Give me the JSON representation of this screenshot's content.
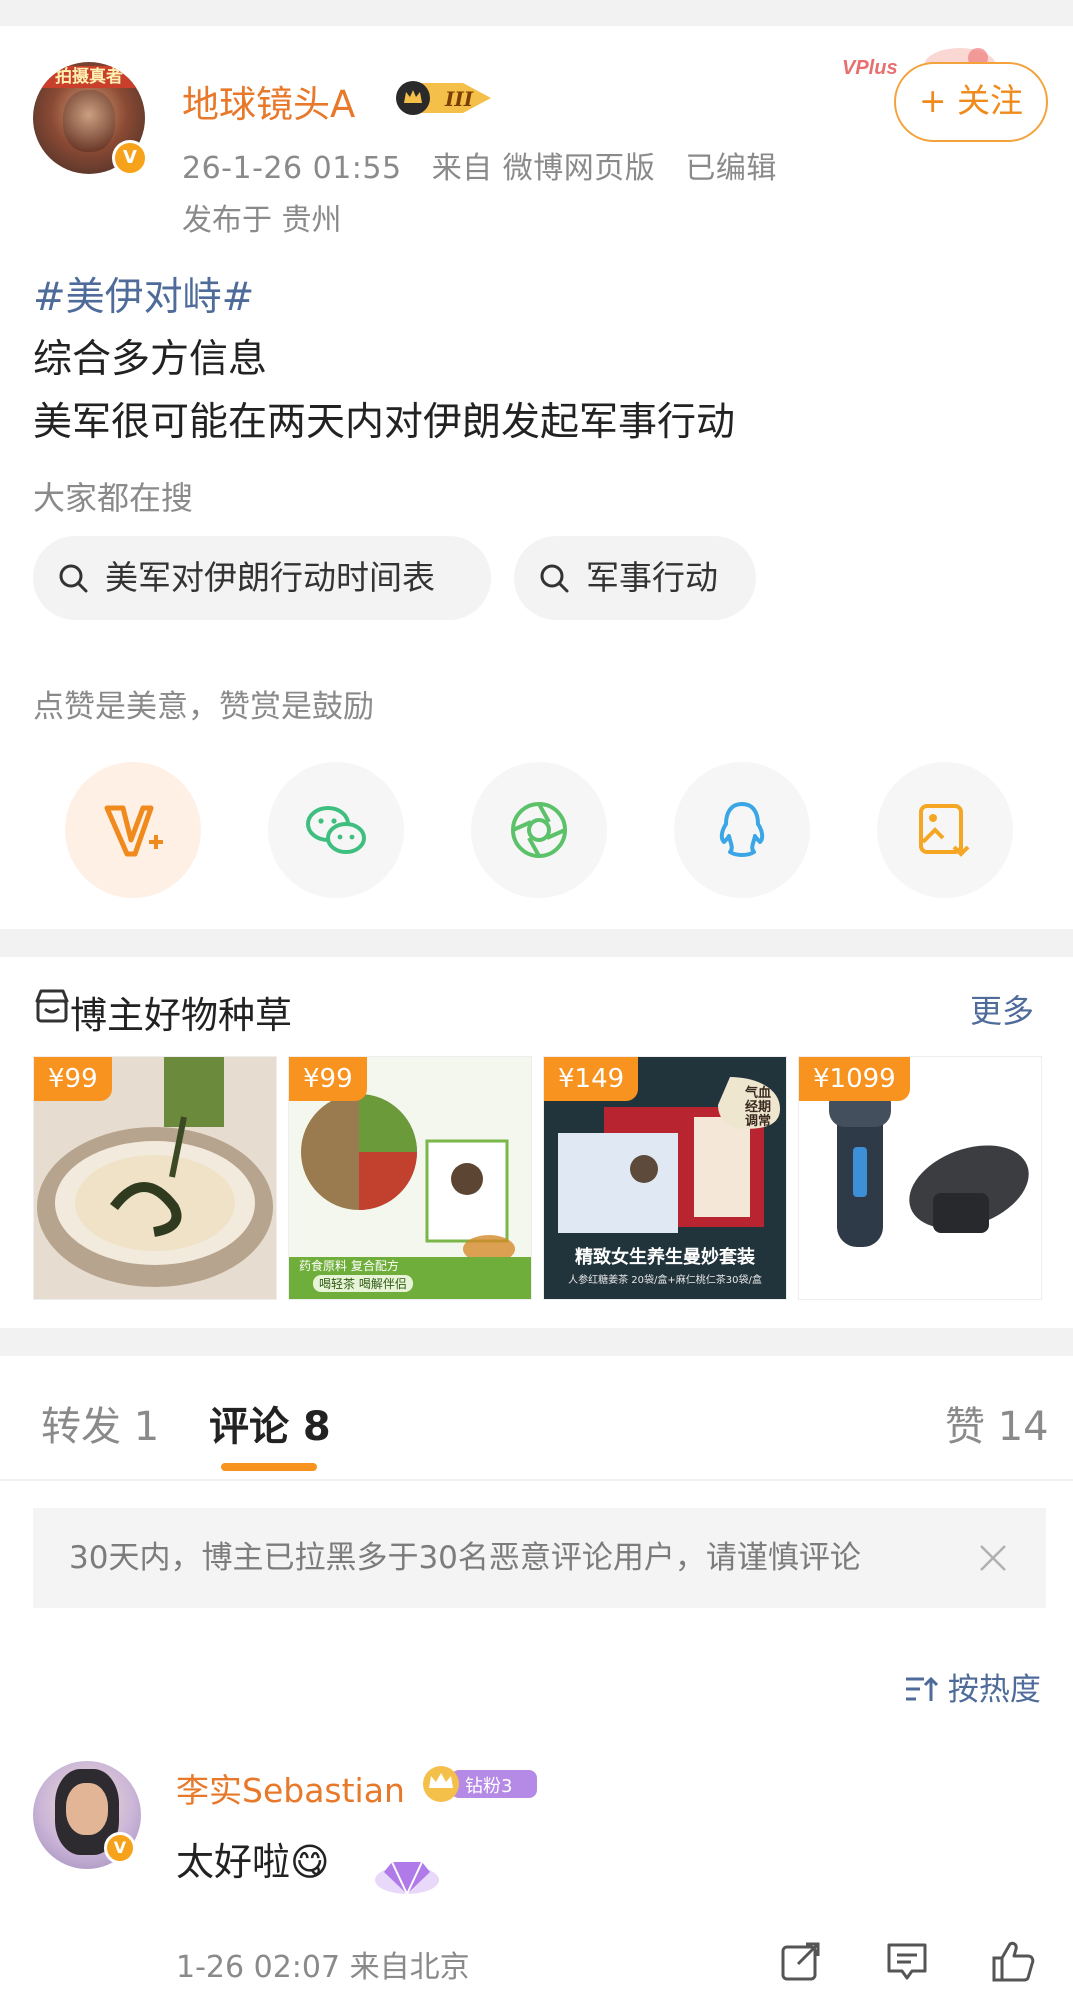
{
  "post": {
    "author": {
      "name": "地球镜头A",
      "level_badge": "III",
      "avatar_banner": "拍摄真者"
    },
    "timestamp": "26-1-26 01:55",
    "source": "来自 微博网页版",
    "edited": "已编辑",
    "location": "发布于 贵州",
    "follow_label": "+ 关注",
    "hashtag": "#美伊对峙#",
    "lines": [
      "综合多方信息",
      "美军很可能在两天内对伊朗发起军事行动"
    ],
    "search_hint": "大家都在搜",
    "search_chips": [
      "美军对伊朗行动时间表",
      "军事行动"
    ],
    "tip_text": "点赞是美意，赞赏是鼓励",
    "share_icons": [
      "vplus-reward-icon",
      "wechat-icon",
      "moments-icon",
      "qq-icon",
      "save-image-icon"
    ]
  },
  "goods": {
    "title": "博主好物种草",
    "more_label": "更多",
    "products": [
      {
        "price": "¥99",
        "icon": "noodles-product"
      },
      {
        "price": "¥99",
        "icon": "herbal-tea-product",
        "caption1": "药食原料 复合配方",
        "caption2": "喝轻茶 喝解伴侣"
      },
      {
        "price": "¥149",
        "icon": "wellness-tea-set",
        "caption1": "精致女生养生曼妙套装",
        "caption2": "人参红糖姜茶 20袋/盒+麻仁桃仁茶30袋/盒",
        "side_tag": "气血 经期 调常"
      },
      {
        "price": "¥1099",
        "icon": "electric-shaver-product"
      }
    ]
  },
  "tabs": {
    "repost": "转发 1",
    "comment": "评论 8",
    "like": "赞 14"
  },
  "notice": {
    "text": "30天内，博主已拉黑多于30名恶意评论用户，请谨慎评论"
  },
  "sort_label": "按热度",
  "comment": {
    "user": "李实Sebastian",
    "fan_badge": "钻粉3",
    "text": "太好啦😋",
    "time": "1-26 02:07  来自北京"
  },
  "colors": {
    "accent_orange": "#f7931e",
    "username_orange": "#e8782a",
    "link_blue": "#4e6b9a",
    "muted_gray": "#8a8a8a"
  }
}
